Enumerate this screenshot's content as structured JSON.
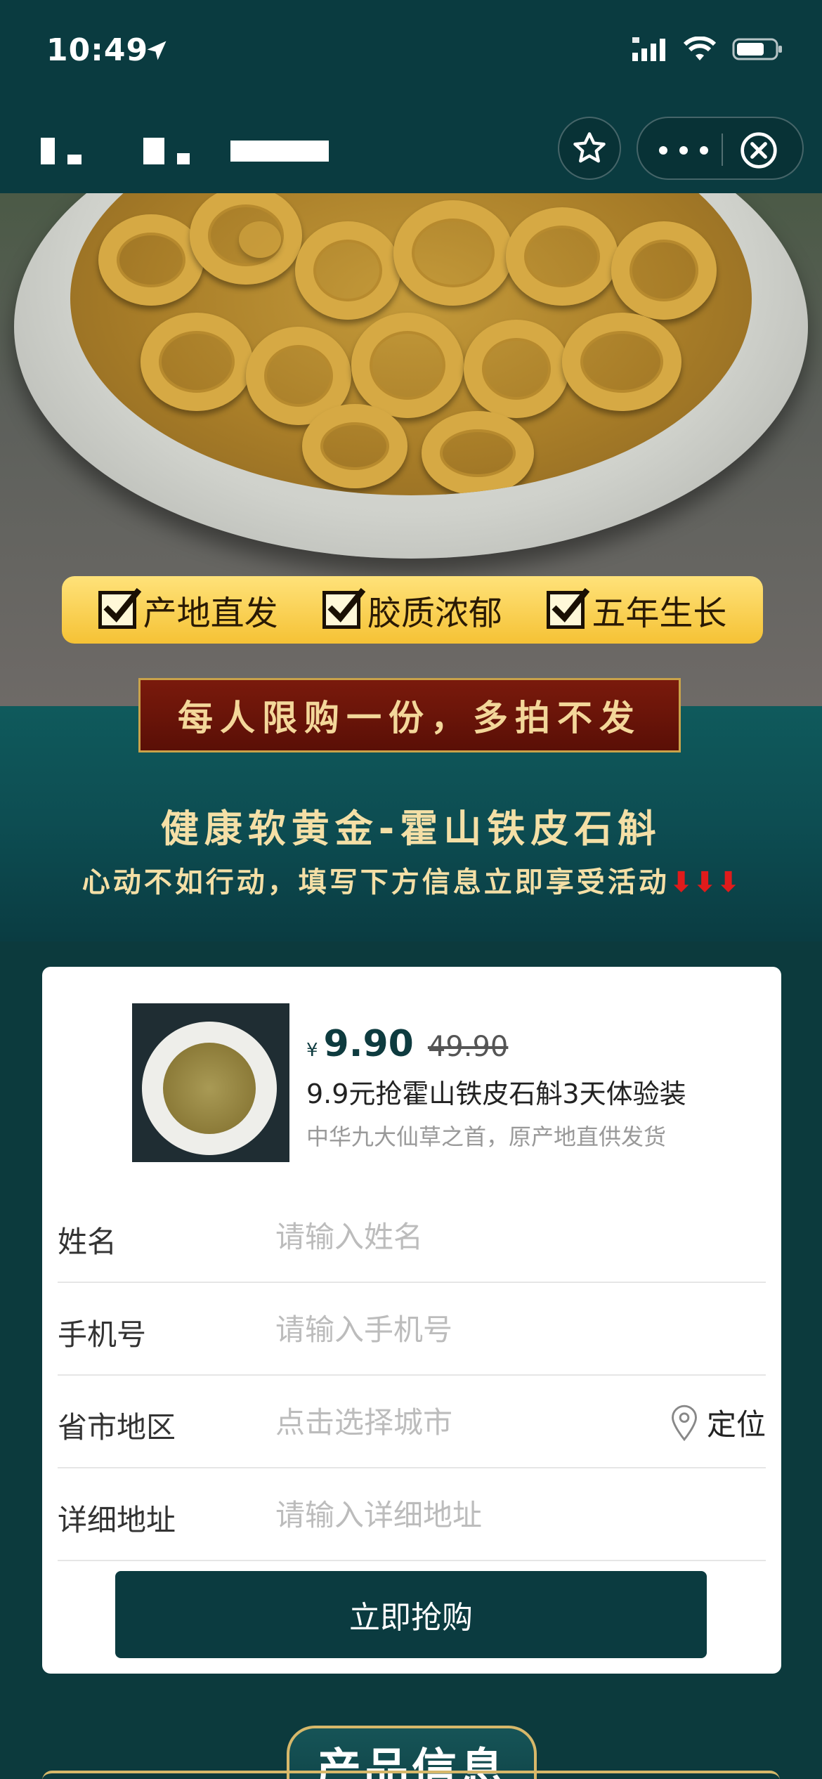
{
  "status_bar": {
    "time": "10:49"
  },
  "nav": {
    "title_obscured": "",
    "icons": [
      "star-icon",
      "more-icon",
      "close-circle-icon"
    ]
  },
  "hero": {
    "features": [
      "产地直发",
      "胶质浓郁",
      "五年生长"
    ],
    "limit_notice": "每人限购一份，多拍不发",
    "title": "健康软黄金-霍山铁皮石斛",
    "subtitle": "心动不如行动，填写下方信息立即享受活动",
    "subtitle_arrows": "⬇⬇⬇"
  },
  "product": {
    "currency": "¥",
    "price": "9.90",
    "original_price": "49.90",
    "title": "9.9元抢霍山铁皮石斛3天体验装",
    "description": "中华九大仙草之首，原产地直供发货"
  },
  "form": {
    "fields": [
      {
        "label": "姓名",
        "placeholder": "请输入姓名"
      },
      {
        "label": "手机号",
        "placeholder": "请输入手机号"
      },
      {
        "label": "省市地区",
        "placeholder": "点击选择城市"
      },
      {
        "label": "详细地址",
        "placeholder": "请输入详细地址"
      }
    ],
    "locate_label": "定位",
    "submit_label": "立即抢购"
  },
  "section": {
    "title": "产品信息"
  },
  "colors": {
    "theme_dark": "#0b3b40",
    "gold": "#f4dfa6",
    "feature_yellow": "#f5c235"
  }
}
